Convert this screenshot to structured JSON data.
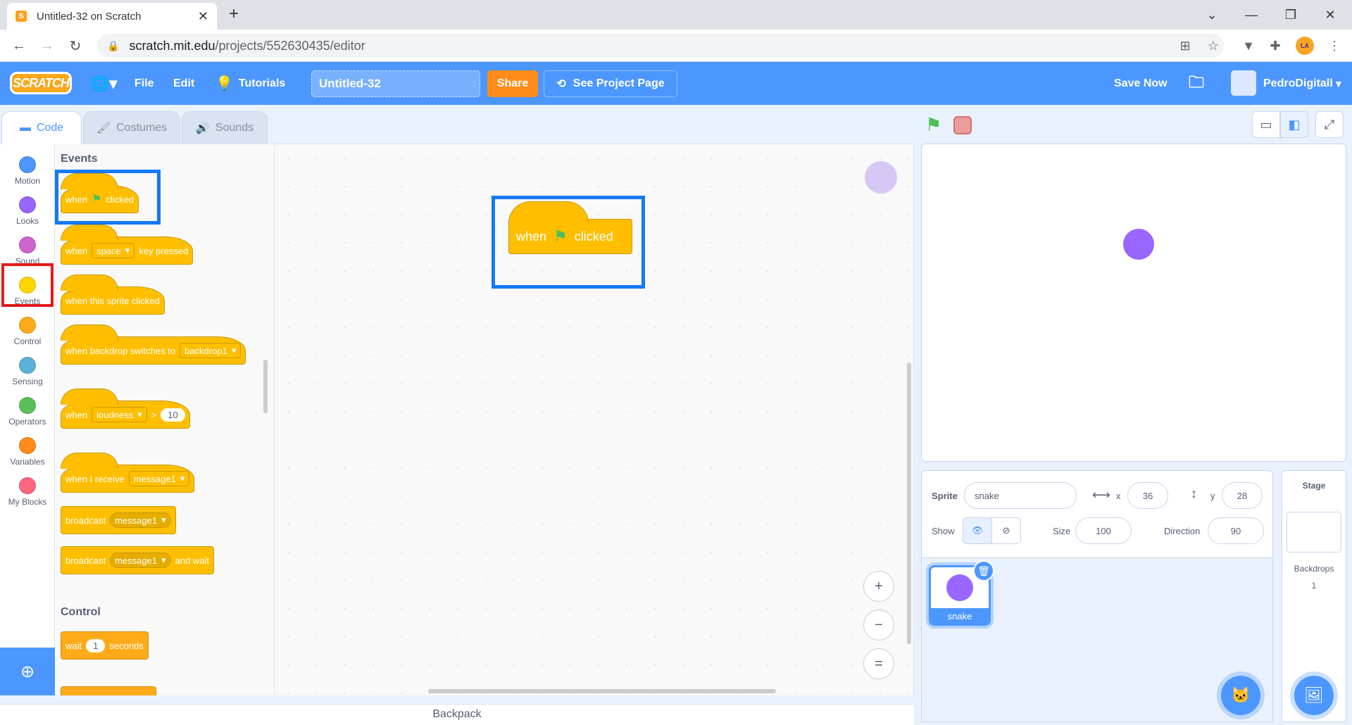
{
  "browser": {
    "tab_title": "Untitled-32 on Scratch",
    "favicon_letter": "S",
    "url_host": "scratch.mit.edu",
    "url_path": "/projects/552630435/editor"
  },
  "menubar": {
    "logo": "SCRATCH",
    "file": "File",
    "edit": "Edit",
    "tutorials": "Tutorials",
    "project_title": "Untitled-32",
    "share": "Share",
    "see_project_page": "See Project Page",
    "save_now": "Save Now",
    "username": "PedroDigitall"
  },
  "tabs": {
    "code": "Code",
    "costumes": "Costumes",
    "sounds": "Sounds"
  },
  "categories": [
    {
      "label": "Motion",
      "color": "#4c97ff"
    },
    {
      "label": "Looks",
      "color": "#9966ff"
    },
    {
      "label": "Sound",
      "color": "#cf63cf"
    },
    {
      "label": "Events",
      "color": "#ffd500"
    },
    {
      "label": "Control",
      "color": "#ffab19"
    },
    {
      "label": "Sensing",
      "color": "#5cb1d6"
    },
    {
      "label": "Operators",
      "color": "#59c059"
    },
    {
      "label": "Variables",
      "color": "#ff8c1a"
    },
    {
      "label": "My Blocks",
      "color": "#ff6680"
    }
  ],
  "palette": {
    "events_heading": "Events",
    "control_heading": "Control",
    "flag_clicked": {
      "when": "when",
      "clicked": "clicked"
    },
    "key_pressed": {
      "when": "when",
      "key": "space",
      "suffix": "key pressed"
    },
    "sprite_clicked": "when this sprite clicked",
    "backdrop_switches": {
      "text": "when backdrop switches to",
      "value": "backdrop1"
    },
    "loudness": {
      "when": "when",
      "sensor": "loudness",
      "op": ">",
      "value": "10"
    },
    "receive": {
      "text": "when I receive",
      "value": "message1"
    },
    "broadcast": {
      "text": "broadcast",
      "value": "message1"
    },
    "broadcast_wait": {
      "text": "broadcast",
      "value": "message1",
      "suffix": "and wait"
    },
    "wait": {
      "text": "wait",
      "value": "1",
      "suffix": "seconds"
    }
  },
  "canvas": {
    "block": {
      "when": "when",
      "clicked": "clicked"
    }
  },
  "zoom": {
    "in": "+",
    "out": "−",
    "reset": "="
  },
  "backpack": "Backpack",
  "sprite_info": {
    "sprite_label": "Sprite",
    "sprite_name": "snake",
    "x_label": "x",
    "x": "36",
    "y_label": "y",
    "y": "28",
    "show_label": "Show",
    "size_label": "Size",
    "size": "100",
    "direction_label": "Direction",
    "direction": "90"
  },
  "sprites": [
    {
      "name": "snake",
      "color": "#9966ff"
    }
  ],
  "stage_pane": {
    "title": "Stage",
    "backdrops_label": "Backdrops",
    "backdrops_count": "1"
  }
}
